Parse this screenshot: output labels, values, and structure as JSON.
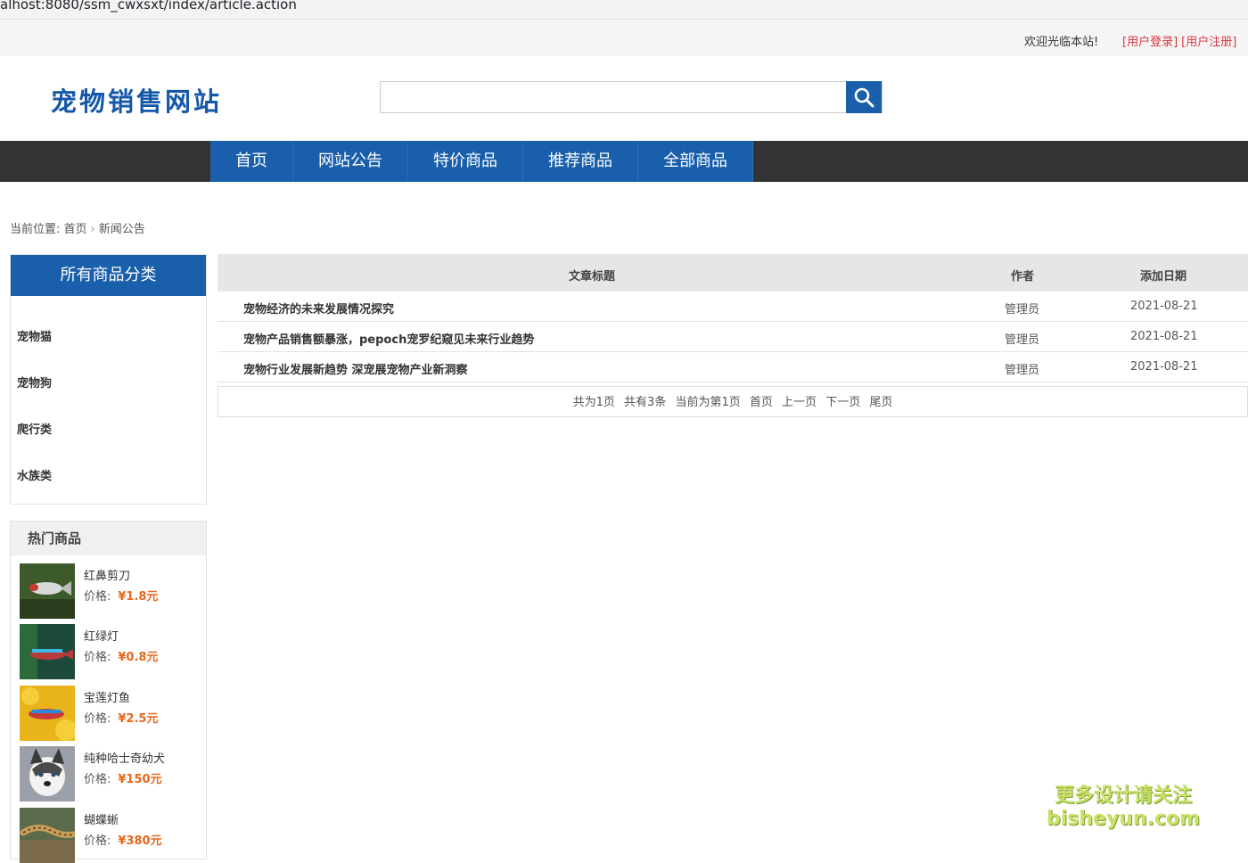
{
  "browser": {
    "url": "alhost:8080/ssm_cwxsxt/index/article.action"
  },
  "topbar": {
    "welcome": "欢迎光临本站!",
    "login": "[用户登录]",
    "register": "[用户注册]"
  },
  "header": {
    "logo": "宠物销售网站",
    "search_placeholder": ""
  },
  "nav": {
    "items": [
      "首页",
      "网站公告",
      "特价商品",
      "推荐商品",
      "全部商品"
    ]
  },
  "breadcrumb": {
    "label": "当前位置:",
    "home": "首页",
    "current": "新闻公告"
  },
  "categories": {
    "title": "所有商品分类",
    "items": [
      "宠物猫",
      "宠物狗",
      "爬行类",
      "水族类"
    ]
  },
  "hot": {
    "title": "热门商品",
    "price_label": "价格:",
    "items": [
      {
        "name": "红鼻剪刀",
        "price": "¥1.8元"
      },
      {
        "name": "红绿灯",
        "price": "¥0.8元"
      },
      {
        "name": "宝莲灯鱼",
        "price": "¥2.5元"
      },
      {
        "name": "纯种哈士奇幼犬",
        "price": "¥150元"
      },
      {
        "name": "蝴蝶蜥",
        "price": "¥380元"
      }
    ]
  },
  "articles": {
    "headers": {
      "title": "文章标题",
      "author": "作者",
      "date": "添加日期"
    },
    "rows": [
      {
        "title": "宠物经济的未来发展情况探究",
        "author": "管理员",
        "date": "2021-08-21"
      },
      {
        "title": "宠物产品销售额暴涨，pepoch宠罗纪窥见未来行业趋势",
        "author": "管理员",
        "date": "2021-08-21"
      },
      {
        "title": "宠物行业发展新趋势 深宠展宠物产业新洞察",
        "author": "管理员",
        "date": "2021-08-21"
      }
    ]
  },
  "pager": {
    "total_pages": "共为1页",
    "total_items": "共有3条",
    "current": "当前为第1页",
    "first": "首页",
    "prev": "上一页",
    "next": "下一页",
    "last": "尾页"
  },
  "watermark": {
    "line1": "更多设计请关注",
    "line2": "bisheyun.com"
  },
  "colors": {
    "primary": "#1a5fab",
    "price": "#e8671b",
    "nav_bg": "#333333",
    "link_red": "#d9363e"
  }
}
